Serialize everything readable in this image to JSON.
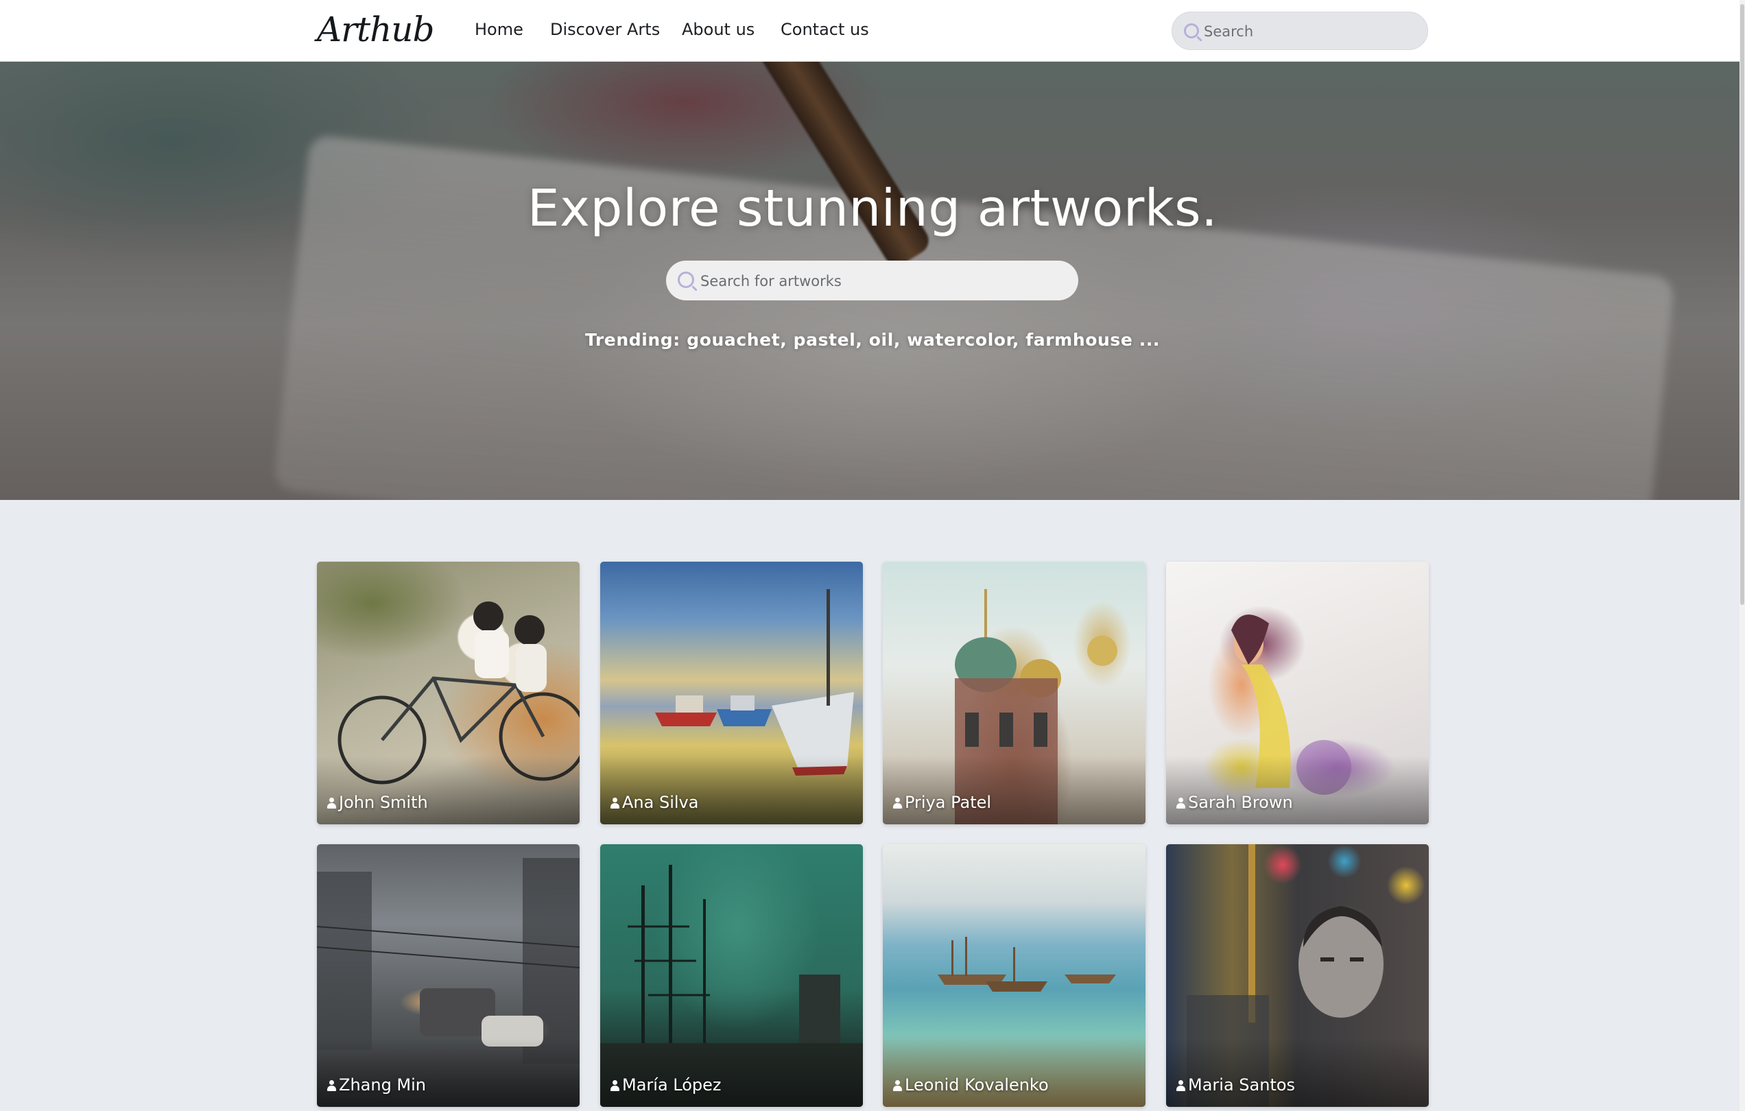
{
  "header": {
    "logo": "Arthub",
    "nav": [
      {
        "label": "Home"
      },
      {
        "label": "Discover Arts"
      },
      {
        "label": "About us"
      },
      {
        "label": "Contact us"
      }
    ],
    "search_placeholder": "Search"
  },
  "hero": {
    "title": "Explore stunning artworks.",
    "search_placeholder": "Search for artworks",
    "trending": "Trending: gouachet, pastel, oil, watercolor, farmhouse ..."
  },
  "gallery": {
    "items": [
      {
        "artist": "John Smith",
        "icon": "person-icon"
      },
      {
        "artist": "Ana Silva",
        "icon": "person-icon"
      },
      {
        "artist": "Priya Patel",
        "icon": "person-icon"
      },
      {
        "artist": "Sarah Brown",
        "icon": "person-icon"
      },
      {
        "artist": "Zhang Min",
        "icon": "person-icon"
      },
      {
        "artist": "María López",
        "icon": "person-icon"
      },
      {
        "artist": "Leonid Kovalenko",
        "icon": "person-icon"
      },
      {
        "artist": "Maria Santos",
        "icon": "person-icon"
      }
    ]
  },
  "colors": {
    "page_background": "#e8ebf0",
    "header_background": "#ffffff",
    "search_icon": "#b7b0d9",
    "hero_text": "#ffffff"
  }
}
